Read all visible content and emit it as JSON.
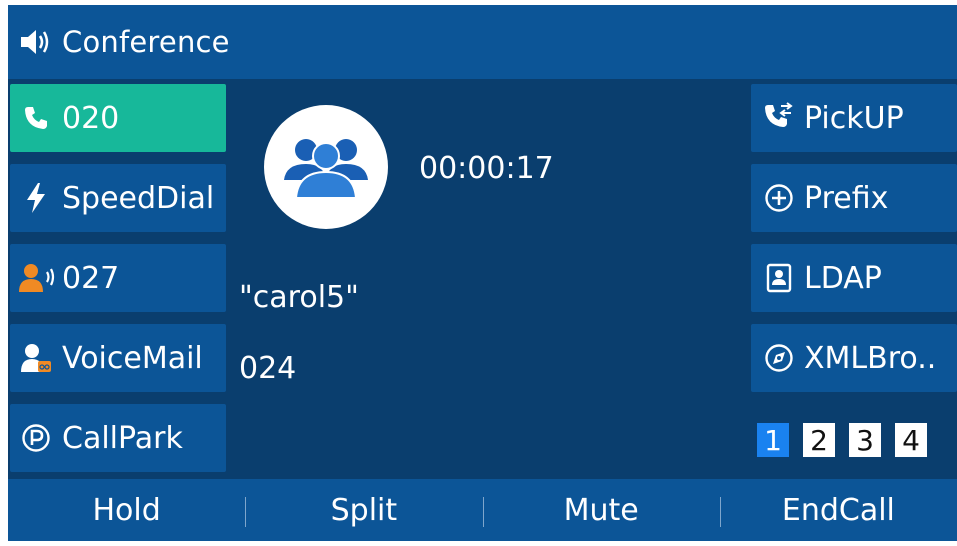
{
  "titlebar": {
    "title": "Conference",
    "icon": "speaker-icon"
  },
  "line_keys_left": [
    {
      "label": "020",
      "icon": "phone-icon",
      "active": true
    },
    {
      "label": "SpeedDial",
      "icon": "lightning-icon",
      "active": false
    },
    {
      "label": "027",
      "icon": "ringing-contact-icon",
      "active": false
    },
    {
      "label": "VoiceMail",
      "icon": "voicemail-icon",
      "active": false
    },
    {
      "label": "CallPark",
      "icon": "park-icon",
      "active": false
    }
  ],
  "line_keys_right": [
    {
      "label": "PickUP",
      "icon": "pickup-icon"
    },
    {
      "label": "Prefix",
      "icon": "plus-circle-icon"
    },
    {
      "label": "LDAP",
      "icon": "contact-card-icon"
    },
    {
      "label": "XMLBro..",
      "icon": "browser-icon"
    }
  ],
  "call": {
    "avatar_icon": "group-icon",
    "duration": "00:00:17",
    "name": "\"carol5\"",
    "number": "024"
  },
  "pages": {
    "items": [
      "1",
      "2",
      "3",
      "4"
    ],
    "current": "1"
  },
  "softkeys": [
    "Hold",
    "Split",
    "Mute",
    "EndCall"
  ],
  "colors": {
    "background": "#0a3e6e",
    "key": "#0c5597",
    "active": "#17b89a",
    "page_current": "#1a82f0"
  }
}
